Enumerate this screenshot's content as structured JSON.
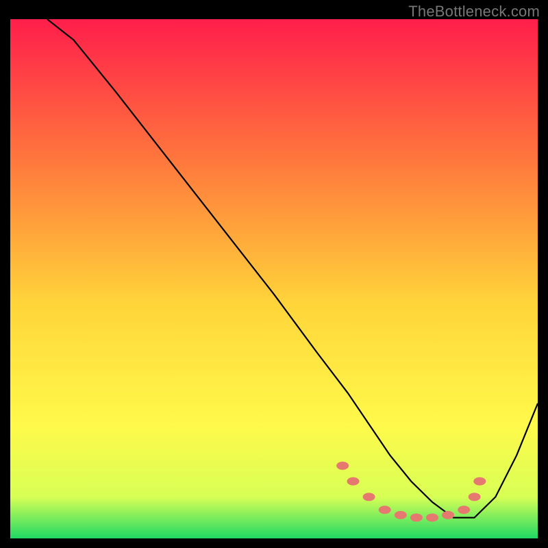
{
  "watermark": "TheBottleneck.com",
  "chart_data": {
    "type": "line",
    "title": "",
    "xlabel": "",
    "ylabel": "",
    "xlim": [
      0,
      100
    ],
    "ylim": [
      0,
      100
    ],
    "background_gradient": {
      "top": "#ff1e4b",
      "mid1": "#ff7a3c",
      "mid2": "#ffd53a",
      "mid3": "#fff94a",
      "bottom": "#1fd964"
    },
    "series": [
      {
        "name": "bottleneck-curve",
        "x": [
          7,
          12,
          20,
          30,
          40,
          50,
          58,
          64,
          68,
          72,
          76,
          80,
          84,
          88,
          92,
          96,
          100
        ],
        "y": [
          100,
          96,
          86,
          73,
          60,
          47,
          36,
          28,
          22,
          16,
          11,
          7,
          4,
          4,
          8,
          16,
          26
        ]
      }
    ],
    "markers": {
      "name": "highlight-dots",
      "points": [
        {
          "x": 63,
          "y": 14
        },
        {
          "x": 65,
          "y": 11
        },
        {
          "x": 68,
          "y": 8
        },
        {
          "x": 71,
          "y": 5.5
        },
        {
          "x": 74,
          "y": 4.5
        },
        {
          "x": 77,
          "y": 4
        },
        {
          "x": 80,
          "y": 4
        },
        {
          "x": 83,
          "y": 4.5
        },
        {
          "x": 86,
          "y": 5.5
        },
        {
          "x": 88,
          "y": 8
        },
        {
          "x": 89,
          "y": 11
        }
      ],
      "color": "#e6796f"
    }
  }
}
